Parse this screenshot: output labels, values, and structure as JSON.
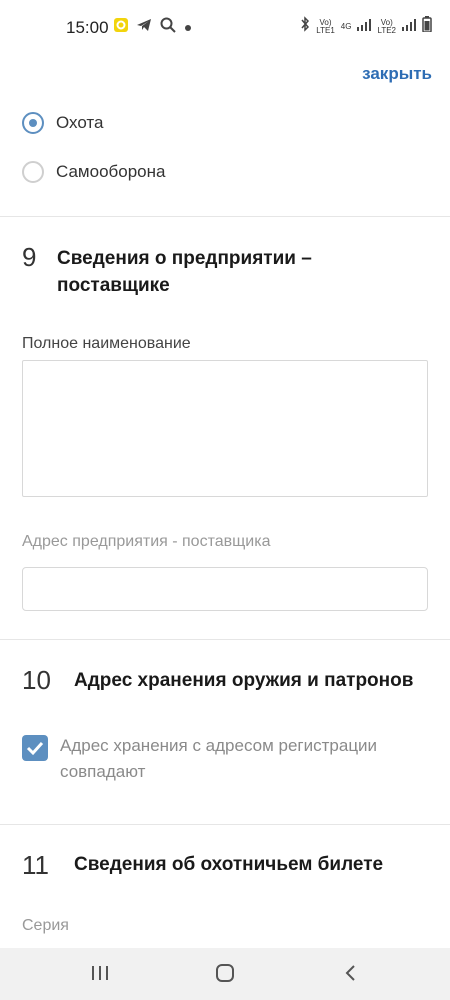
{
  "status_bar": {
    "time": "15:00",
    "network_label_1": "Vo)\nLTE1",
    "network_label_4g": "4G",
    "network_label_2": "Vo)\nLTE2",
    "icons": [
      "app-notification-icon",
      "telegram-icon",
      "search-icon",
      "dot-icon",
      "bluetooth-icon",
      "signal-icon",
      "battery-icon"
    ]
  },
  "header": {
    "close_label": "закрыть"
  },
  "purpose": {
    "options": [
      {
        "label": "Охота",
        "selected": true
      },
      {
        "label": "Самооборона",
        "selected": false
      }
    ]
  },
  "section9": {
    "number": "9",
    "title_line1": "Сведения о предприятии –",
    "title_line2": "поставщике",
    "full_name_label": "Полное наименование",
    "full_name_value": "",
    "address_label": "Адрес предприятия - поставщика",
    "address_value": ""
  },
  "section10": {
    "number": "10",
    "title": "Адрес хранения оружия и патронов",
    "checkbox_line1": "Адрес хранения с адресом регистрации",
    "checkbox_line2": "совпадают",
    "checked": true
  },
  "section11": {
    "number": "11",
    "title": "Сведения об охотничьем билете",
    "series_label": "Серия"
  },
  "colors": {
    "accent": "#5d8fc0",
    "link": "#2e6db4",
    "divider": "#e6e6e6"
  }
}
